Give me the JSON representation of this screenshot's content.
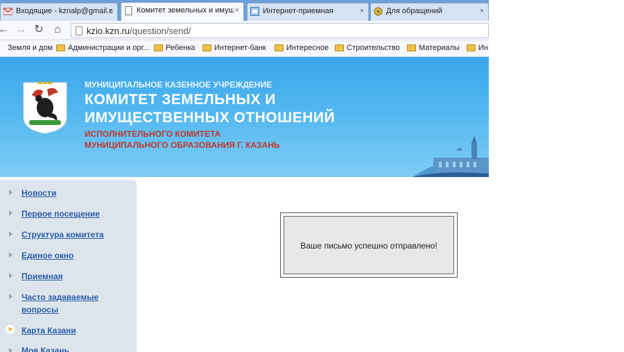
{
  "browser": {
    "tabs": [
      {
        "label": "Входящие - kznalp@gmail.co",
        "icon": "gmail-icon",
        "close": "×"
      },
      {
        "label": "Комитет земельных и имущ",
        "icon": "page-icon",
        "close": "×"
      },
      {
        "label": "Интернет-приемная",
        "icon": "site-icon",
        "close": "×"
      },
      {
        "label": "Для обращений",
        "icon": "emblem-icon",
        "close": "×"
      }
    ],
    "url_host": "kzio.kzn.ru",
    "url_path": "/question/send/",
    "bookmarks": [
      "Земля и дом",
      "Администрации и орг...",
      "Ребенка",
      "Интернет-банк",
      "Интересное",
      "Строительство",
      "Материалы",
      "Ин"
    ],
    "nav": {
      "back": "←",
      "forward": "→",
      "reload": "↻",
      "home": "⌂"
    }
  },
  "banner": {
    "line1": "МУНИЦИПАЛЬНОЕ КАЗЕННОЕ УЧРЕЖДЕНИЕ",
    "line2": "КОМИТЕТ ЗЕМЕЛЬНЫХ И",
    "line3": "ИМУЩЕСТВЕННЫХ ОТНОШЕНИЙ",
    "line4": "ИСПОЛНИТЕЛЬНОГО КОМИТЕТА",
    "line5": "МУНИЦИПАЛЬНОГО ОБРАЗОВАНИЯ Г. КАЗАНЬ"
  },
  "sidebar": {
    "items": [
      {
        "label": "Новости"
      },
      {
        "label": "Первое посещение"
      },
      {
        "label": "Структура комитета"
      },
      {
        "label": "Единое окно"
      },
      {
        "label": "Приемная"
      },
      {
        "label": "Часто задаваемые вопросы"
      },
      {
        "label": "Карта Казани"
      },
      {
        "label": "Моя Казань"
      }
    ]
  },
  "message": {
    "text": "Ваше письмо успешно отправлено!"
  }
}
